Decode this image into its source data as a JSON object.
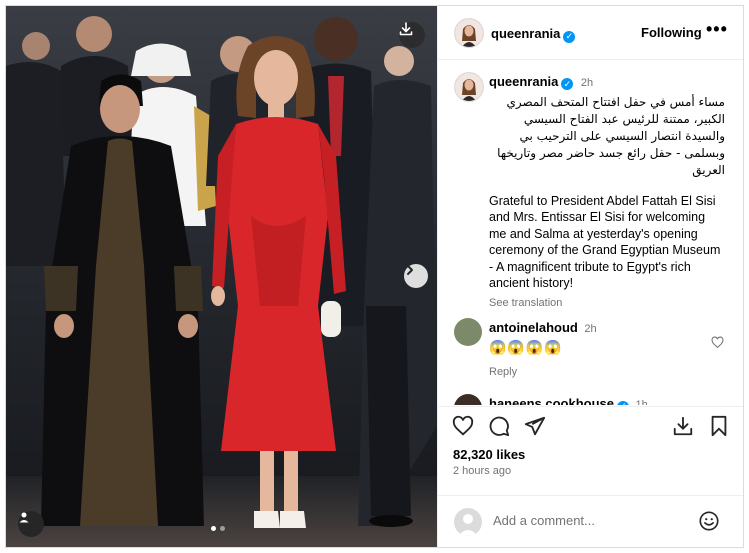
{
  "post": {
    "username": "queenrania",
    "follow_label": "Following",
    "more_label": "•••",
    "time": "2h",
    "caption_ar": "مساء أمس في حفل افتتاح المتحف المصري الكبير، ممتنة للرئيس عبد الفتاح السيسي والسيدة انتصار السيسي على الترحيب بي وبسلمى -  حفل رائع جسد حاضر مصر وتاريخها العريق",
    "caption_en": "Grateful to President Abdel Fattah El Sisi and Mrs. Entissar El Sisi for welcoming me and Salma at yesterday's opening ceremony of the Grand Egyptian Museum - A magnificent tribute to Egypt's rich ancient history!",
    "see_translation": "See translation"
  },
  "comments": [
    {
      "username": "antoinelahoud",
      "time": "2h",
      "text": "😱😱😱😱",
      "reply_label": "Reply"
    },
    {
      "username": "haneens.cookhouse",
      "time": "1h"
    }
  ],
  "actions": {
    "like_icon": "heart-icon",
    "comment_icon": "comment-icon",
    "share_icon": "send-icon",
    "save_icon": "bookmark-icon",
    "download_icon": "download-icon"
  },
  "likes_count": "82,320 likes",
  "posted_ago": "2 hours ago",
  "add_comment_placeholder": "Add a comment...",
  "colors": {
    "verified": "#0095f6",
    "muted_text": "#737373",
    "border": "#dbdbdb",
    "dress_red": "#d9262b"
  }
}
